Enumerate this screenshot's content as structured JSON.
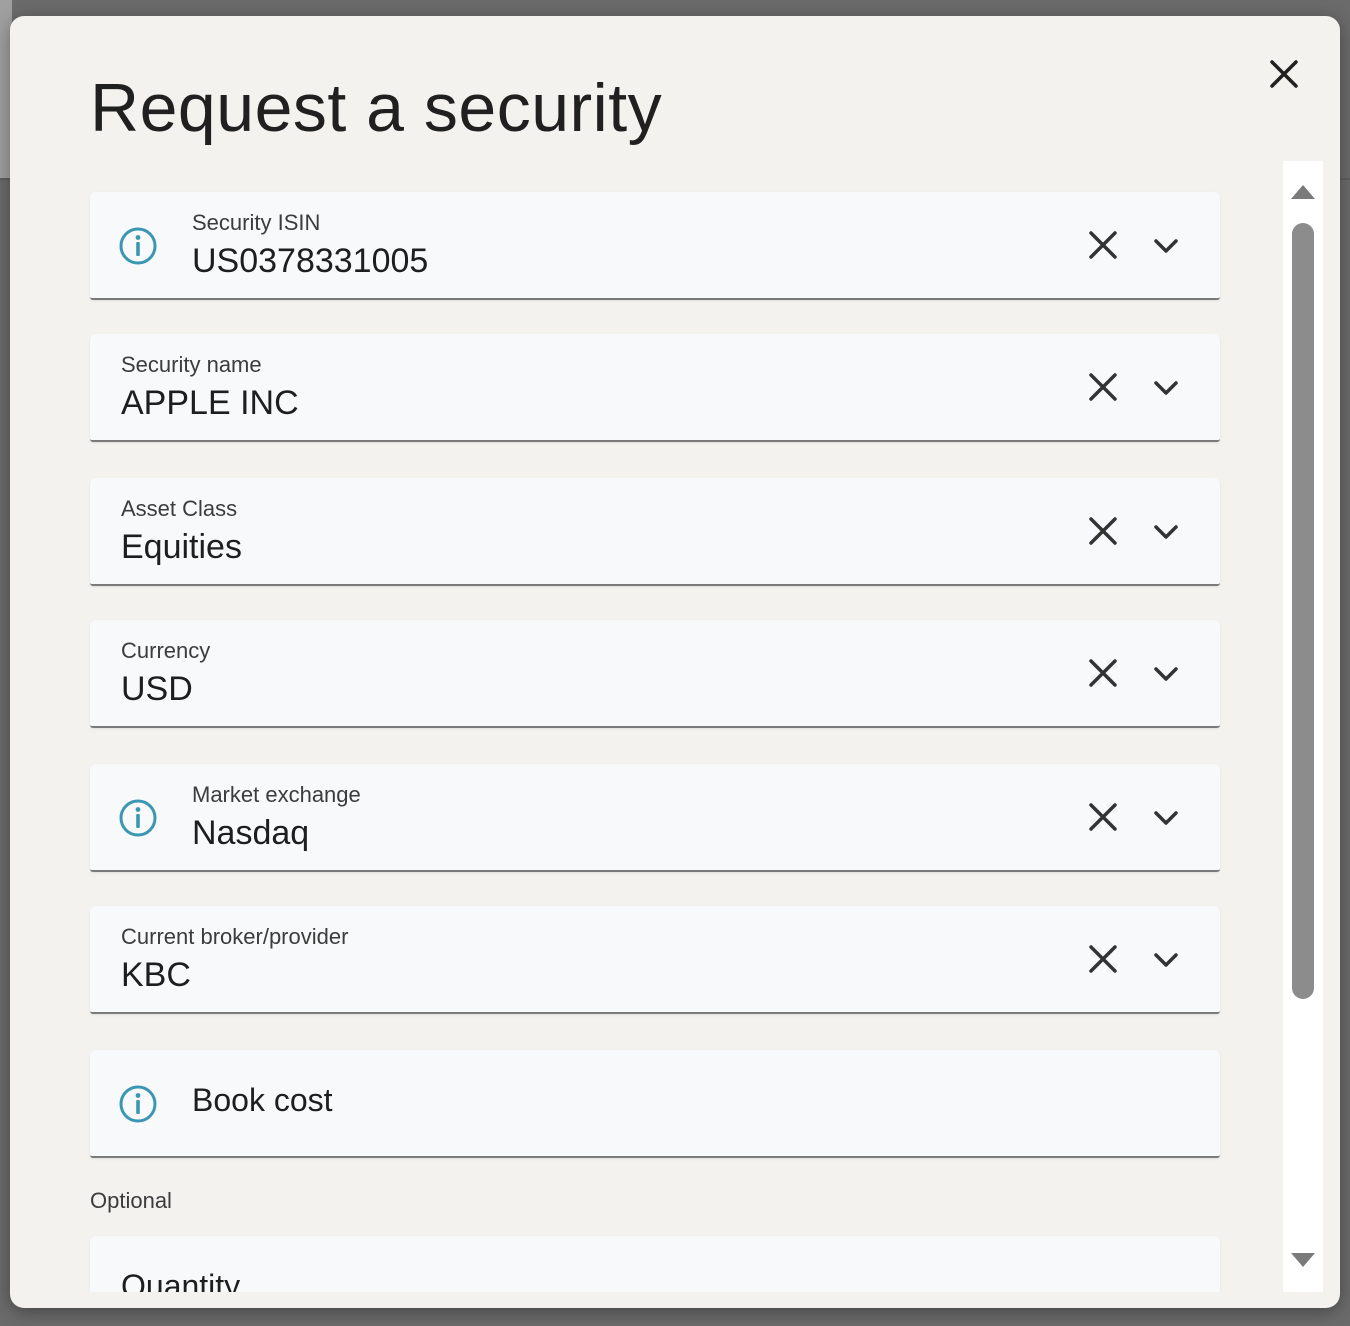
{
  "dialog": {
    "title": "Request a security",
    "close_label": "close"
  },
  "fields": [
    {
      "label": "Security ISIN",
      "value": "US0378331005",
      "has_info": true
    },
    {
      "label": "Security name",
      "value": "APPLE INC",
      "has_info": false
    },
    {
      "label": "Asset Class",
      "value": "Equities",
      "has_info": false
    },
    {
      "label": "Currency",
      "value": "USD",
      "has_info": false
    },
    {
      "label": "Market exchange",
      "value": "Nasdaq",
      "has_info": true
    },
    {
      "label": "Current broker/provider",
      "value": "KBC",
      "has_info": false
    }
  ],
  "book_cost": {
    "placeholder": "Book cost",
    "helper": "Optional"
  },
  "quantity": {
    "placeholder": "Quantity"
  },
  "colors": {
    "info_icon": "#3a97b4",
    "modal_bg": "#f3f2ef",
    "field_bg": "#f8f9fa",
    "overlay": "#6b6b6b"
  },
  "icons": {
    "close": "close-icon",
    "info": "info-icon",
    "clear": "clear-icon",
    "dropdown": "chevron-down-icon",
    "scroll_up": "arrow-up-icon",
    "scroll_down": "arrow-down-icon"
  }
}
